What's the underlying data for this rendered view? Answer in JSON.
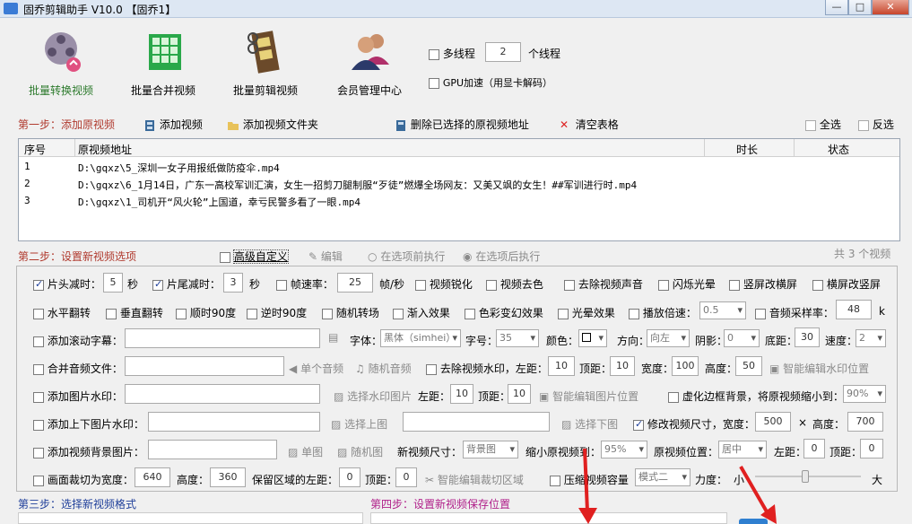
{
  "window": {
    "title": "固乔剪辑助手 V10.0 【固乔1】"
  },
  "toolbar": {
    "items": [
      {
        "label": "批量转换视频"
      },
      {
        "label": "批量合并视频"
      },
      {
        "label": "批量剪辑视频"
      },
      {
        "label": "会员管理中心"
      }
    ],
    "multithread_label": "多线程",
    "thread_count": "2",
    "thread_unit": "个线程",
    "gpu_label": "GPU加速（用显卡解码）"
  },
  "step1": {
    "title": "第一步：添加原视频",
    "add_video": "添加视频",
    "add_folder": "添加视频文件夹",
    "delete_selected": "删除已选择的原视频地址",
    "clear_table": "清空表格",
    "select_all": "全选",
    "invert": "反选"
  },
  "table": {
    "headers": [
      "序号",
      "原视频地址",
      "时长",
      "状态"
    ],
    "rows": [
      {
        "no": "1",
        "path": "D:\\gqxz\\5_深圳一女子用报纸做防疫伞.mp4"
      },
      {
        "no": "2",
        "path": "D:\\gqxz\\6_1月14日，广东一高校军训汇演，女生一招剪刀腿制服“歹徒”燃爆全场网友：又美又飒的女生！##军训进行时.mp4"
      },
      {
        "no": "3",
        "path": "D:\\gqxz\\1_司机开“风火轮”上国道，幸亏民警多看了一眼.mp4"
      }
    ]
  },
  "step2": {
    "title": "第二步：设置新视频选项",
    "advanced": "高级自定义",
    "edit": "编辑",
    "before": "在选项前执行",
    "after": "在选项后执行",
    "count": "共 3 个视频"
  },
  "opts": {
    "head_cut": "片头减时：",
    "head_val": "5",
    "sec": "秒",
    "tail_cut": "片尾减时：",
    "tail_val": "3",
    "sec2": "秒",
    "fps": "帧速率：",
    "fps_val": "25",
    "fps_unit": "帧/秒",
    "sharpen": "视频锐化",
    "decolor": "视频去色",
    "remove_audio": "去除视频声音",
    "flash": "闪烁光晕",
    "v2h": "竖屏改横屏",
    "h2v": "横屏改竖屏",
    "hflip": "水平翻转",
    "vflip": "垂直翻转",
    "r90": "顺时90度",
    "l90": "逆时90度",
    "random_trans": "随机转场",
    "fadein": "渐入效果",
    "color_change": "色彩变幻效果",
    "halo": "光晕效果",
    "speed": "播放倍速：",
    "speed_val": "0.5",
    "sample": "音频采样率：",
    "sample_val": "48",
    "k": "k",
    "scroll_sub": "添加滚动字幕：",
    "font": "字体：",
    "font_val": "黑体（simhei）",
    "size": "字号：",
    "size_val": "35",
    "color": "颜色：",
    "dir": "方向：",
    "dir_val": "向左",
    "shadow": "阴影：",
    "shadow_val": "0",
    "bottom": "底距：",
    "bottom_val": "30",
    "spd": "速度：",
    "spd_val": "2",
    "merge_audio": "合并音频文件：",
    "single_audio": "单个音频",
    "random_audio": "随机音频",
    "remove_wm": "去除视频水印，左距：",
    "wm_left": "10",
    "top_dist": "顶距：",
    "wm_top": "10",
    "width": "宽度：",
    "wm_w": "100",
    "height": "高度：",
    "wm_h": "50",
    "smart_wm": "智能编辑水印位置",
    "img_wm": "添加图片水印：",
    "choose_wm": "选择水印图片",
    "left": "左距：",
    "img_left": "10",
    "top2": "顶距：",
    "img_top": "10",
    "smart_img": "智能编辑图片位置",
    "blur_bg": "虚化边框背景，将原视频缩小到：",
    "blur_val": "90%",
    "updown_wm": "添加上下图片水印：",
    "choose_up": "选择上图",
    "choose_down": "选择下图",
    "resize": "修改视频尺寸，宽度：",
    "rw": "500",
    "x": "×",
    "rh_label": "高度：",
    "rh": "700",
    "bg_img": "添加视频背景图片：",
    "single_img": "单图",
    "random_img": "随机图",
    "new_size": "新视频尺寸：",
    "new_size_val": "背景图",
    "shrink": "缩小原视频到：",
    "shrink_val": "95%",
    "pos": "原视频位置：",
    "pos_val": "居中",
    "pos_left": "左距：",
    "pos_left_val": "0",
    "pos_top": "顶距：",
    "pos_top_val": "0",
    "crop": "画面裁切为宽度：",
    "crop_w": "640",
    "crop_h_label": "高度：",
    "crop_h": "360",
    "keep": "保留区域的左距：",
    "keep_left": "0",
    "keep_top_label": "顶距：",
    "keep_top": "0",
    "smart_crop": "智能编辑裁切区域",
    "compress": "压缩视频容量",
    "mode_val": "模式二",
    "force": "力度：",
    "small": "小",
    "big": "大"
  },
  "step3": {
    "title": "第三步：选择新视频格式"
  },
  "step4": {
    "title": "第四步：设置新视频保存位置"
  },
  "colors": {
    "accent_red": "#b03a2e",
    "arrow": "#e02020",
    "step3": "#1f3f9a",
    "step4": "#b0208a"
  }
}
